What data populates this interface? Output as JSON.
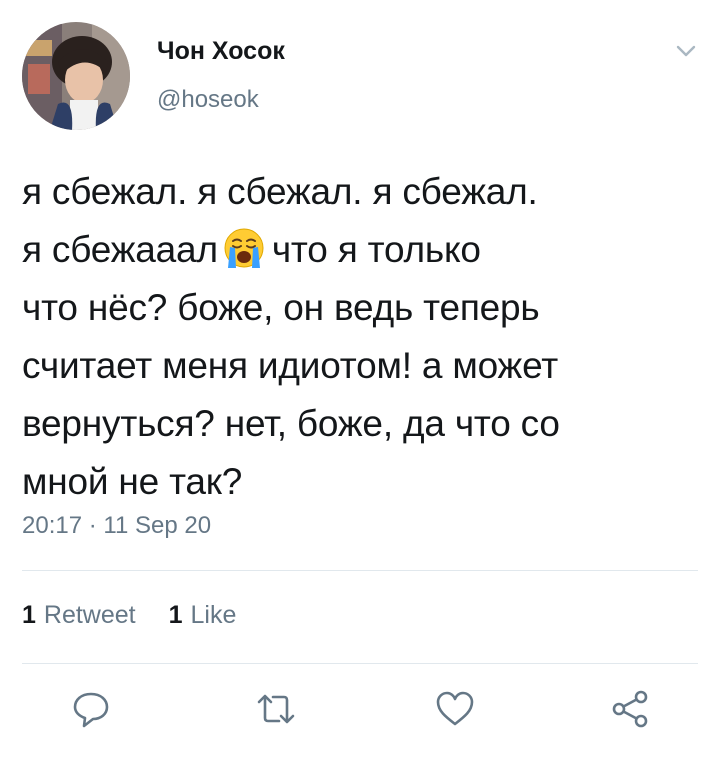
{
  "header": {
    "display_name": "Чон Хосок",
    "handle": "@hoseok",
    "avatar_icon": "avatar",
    "menu_icon": "chevron-down-icon"
  },
  "tweet": {
    "lines": [
      "я сбежал. я сбежал. я сбежал.",
      {
        "before": "я сбежааал",
        "emoji": "loudly-crying-face-emoji",
        "after": "что я только"
      },
      "что нёс? боже, он ведь теперь",
      "считает меня идиотом! а может",
      "вернуться? нет, боже, да что со",
      "мной не так?"
    ],
    "timestamp": "20:17 · 11 Sep 20"
  },
  "stats": {
    "retweet_count": "1",
    "retweet_label": "Retweet",
    "like_count": "1",
    "like_label": "Like"
  },
  "actions": [
    {
      "name": "reply-icon"
    },
    {
      "name": "retweet-icon"
    },
    {
      "name": "like-icon"
    },
    {
      "name": "share-icon"
    }
  ],
  "colors": {
    "text": "#14171a",
    "secondary_text": "#657786",
    "divider": "#e1e8ed"
  }
}
